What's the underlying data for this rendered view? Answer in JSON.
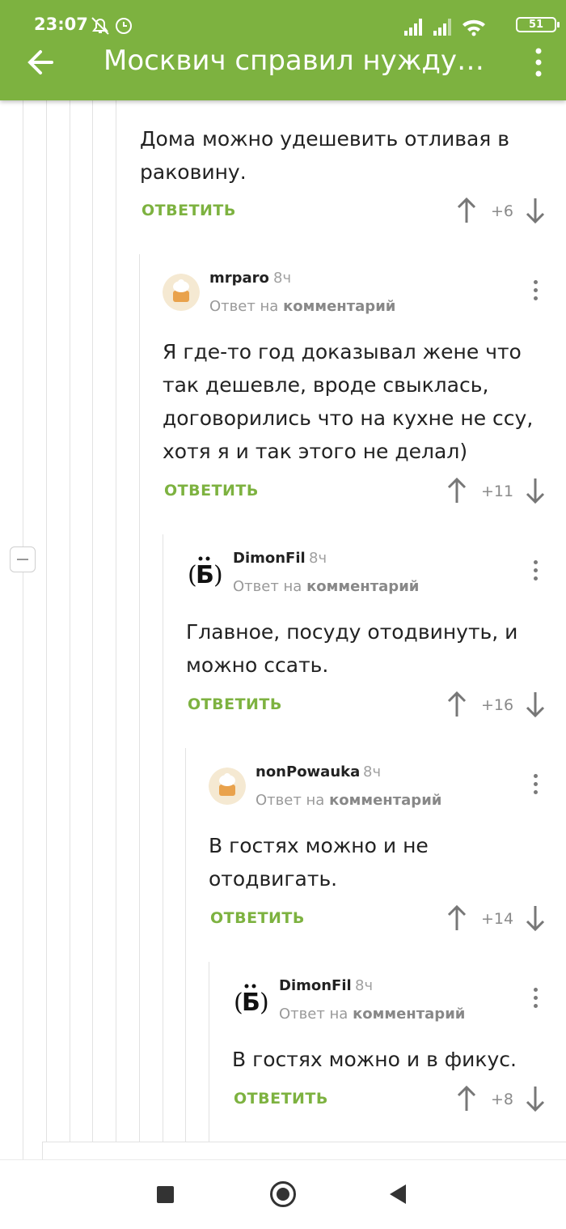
{
  "status_bar": {
    "time": "23:07",
    "battery": "51"
  },
  "app_bar": {
    "title": "Москвич справил нужду в..."
  },
  "comments": [
    {
      "text": "Дома можно удешевить отливая в раковину.",
      "reply_label": "ОТВЕТИТЬ",
      "score": "+6"
    },
    {
      "author": "mrparo",
      "time": "8ч",
      "reply_to_prefix": "Ответ на",
      "reply_to_link": "комментарий",
      "text": "Я где-то год доказывал жене что так дешевле, вроде свыклась, договорились что на кухне не ссу, хотя я и так этого не делал)",
      "reply_label": "ОТВЕТИТЬ",
      "score": "+11"
    },
    {
      "author": "DimonFil",
      "avatar_letter": "Ё",
      "time": "8ч",
      "reply_to_prefix": "Ответ на",
      "reply_to_link": "комментарий",
      "text": "Главное, посуду отодвинуть, и можно ссать.",
      "reply_label": "ОТВЕТИТЬ",
      "score": "+16"
    },
    {
      "author": "nonPowauka",
      "time": "8ч",
      "reply_to_prefix": "Ответ на",
      "reply_to_link": "комментарий",
      "text": "В гостях можно и не отодвигать.",
      "reply_label": "ОТВЕТИТЬ",
      "score": "+14"
    },
    {
      "author": "DimonFil",
      "avatar_letter": "Ё",
      "time": "8ч",
      "reply_to_prefix": "Ответ на",
      "reply_to_link": "комментарий",
      "text": "В гостях можно и в фикус.",
      "reply_label": "ОТВЕТИТЬ",
      "score": "+8"
    }
  ],
  "colors": {
    "accent": "#7db240",
    "text": "#222222",
    "muted": "#999999"
  }
}
